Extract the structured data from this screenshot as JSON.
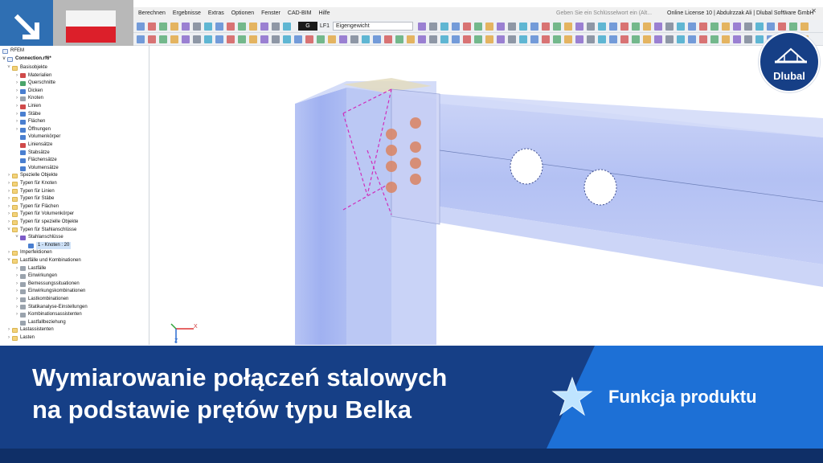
{
  "menu": {
    "items": [
      "Berechnen",
      "Ergebnisse",
      "Extras",
      "Optionen",
      "Fenster",
      "CAD-BIM",
      "Hilfe"
    ],
    "search_placeholder": "Geben Sie ein Schlüsselwort ein (Alt...",
    "license": "Online License 10 | Abdulrzzak Ali | Dlubal Software GmbH"
  },
  "toolbar": {
    "load_case_box": "G",
    "load_case_id": "LF1",
    "load_case_name": "Eigengewicht"
  },
  "navigator": {
    "root": "RFEM",
    "file": "Connection.rf6*",
    "items": [
      {
        "label": "Basisobjekte",
        "level": 1,
        "icon": "folder",
        "chev": "v"
      },
      {
        "label": "Materialien",
        "level": 2,
        "icon": "red",
        "chev": ">"
      },
      {
        "label": "Querschnitte",
        "level": 2,
        "icon": "green",
        "chev": ">"
      },
      {
        "label": "Dicken",
        "level": 2,
        "icon": "blue",
        "chev": ">"
      },
      {
        "label": "Knoten",
        "level": 2,
        "icon": "gray",
        "chev": ">"
      },
      {
        "label": "Linien",
        "level": 2,
        "icon": "red",
        "chev": ">"
      },
      {
        "label": "Stäbe",
        "level": 2,
        "icon": "blue",
        "chev": ">"
      },
      {
        "label": "Flächen",
        "level": 2,
        "icon": "blue",
        "chev": ">"
      },
      {
        "label": "Öffnungen",
        "level": 2,
        "icon": "blue",
        "chev": ">"
      },
      {
        "label": "Volumenkörper",
        "level": 2,
        "icon": "blue",
        "chev": ""
      },
      {
        "label": "Liniensätze",
        "level": 2,
        "icon": "red",
        "chev": ""
      },
      {
        "label": "Stabsätze",
        "level": 2,
        "icon": "blue",
        "chev": ""
      },
      {
        "label": "Flächensätze",
        "level": 2,
        "icon": "blue",
        "chev": ""
      },
      {
        "label": "Volumensätze",
        "level": 2,
        "icon": "blue",
        "chev": ""
      },
      {
        "label": "Spezielle Objekte",
        "level": 1,
        "icon": "folder",
        "chev": ">"
      },
      {
        "label": "Typen für Knoten",
        "level": 1,
        "icon": "folder",
        "chev": ">"
      },
      {
        "label": "Typen für Linien",
        "level": 1,
        "icon": "folder",
        "chev": ">"
      },
      {
        "label": "Typen für Stäbe",
        "level": 1,
        "icon": "folder",
        "chev": ">"
      },
      {
        "label": "Typen für Flächen",
        "level": 1,
        "icon": "folder",
        "chev": ">"
      },
      {
        "label": "Typen für Volumenkörper",
        "level": 1,
        "icon": "folder",
        "chev": ">"
      },
      {
        "label": "Typen für spezielle Objekte",
        "level": 1,
        "icon": "folder",
        "chev": ">"
      },
      {
        "label": "Typen für Stahlanschlüsse",
        "level": 1,
        "icon": "folder",
        "chev": "v"
      },
      {
        "label": "Stahlanschlüsse",
        "level": 2,
        "icon": "purple",
        "chev": "v"
      },
      {
        "label": "1 - Knoten : 20",
        "level": 3,
        "icon": "blue",
        "chev": "",
        "selected": true
      },
      {
        "label": "Imperfektionen",
        "level": 1,
        "icon": "folder",
        "chev": ">"
      },
      {
        "label": "Lastfälle und Kombinationen",
        "level": 1,
        "icon": "folder",
        "chev": "v"
      },
      {
        "label": "Lastfälle",
        "level": 2,
        "icon": "gray",
        "chev": ">"
      },
      {
        "label": "Einwirkungen",
        "level": 2,
        "icon": "gray",
        "chev": ">"
      },
      {
        "label": "Bemessungssituationen",
        "level": 2,
        "icon": "gray",
        "chev": ">"
      },
      {
        "label": "Einwirkungskombinationen",
        "level": 2,
        "icon": "gray",
        "chev": ">"
      },
      {
        "label": "Lastkombinationen",
        "level": 2,
        "icon": "gray",
        "chev": ">"
      },
      {
        "label": "Statikanalyse-Einstellungen",
        "level": 2,
        "icon": "gray",
        "chev": ">"
      },
      {
        "label": "Kombinationsassistenten",
        "level": 2,
        "icon": "gray",
        "chev": ">"
      },
      {
        "label": "Lastfallbeziehung",
        "level": 2,
        "icon": "gray",
        "chev": ""
      },
      {
        "label": "Lastassistenten",
        "level": 1,
        "icon": "folder",
        "chev": ">"
      },
      {
        "label": "Lasten",
        "level": 1,
        "icon": "folder",
        "chev": ">"
      }
    ]
  },
  "axes": {
    "x": "X",
    "z": "Z"
  },
  "logo": {
    "text": "Dlubal"
  },
  "banner": {
    "title_line1": "Wymiarowanie połączeń stalowych",
    "title_line2": "na podstawie prętów typu Belka",
    "feature_label": "Funkcja produktu"
  },
  "colors": {
    "banner_dark": "#163f86",
    "banner_accent": "#1d70d6",
    "flag_red": "#dc1f2a",
    "arrow_tile": "#2f6fb3",
    "steel_blue": "#8fa6ee"
  }
}
